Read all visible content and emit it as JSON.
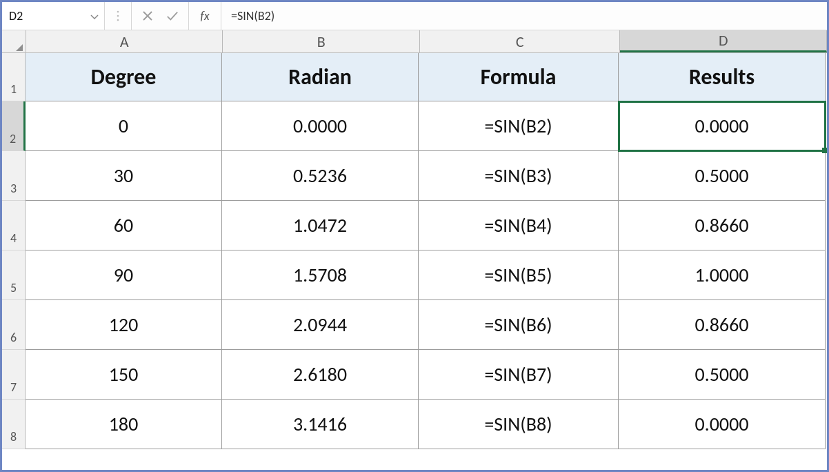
{
  "nameBox": {
    "value": "D2"
  },
  "formulaBar": {
    "fxLabel": "fx",
    "formula": "=SIN(B2)"
  },
  "columns": [
    "A",
    "B",
    "C",
    "D"
  ],
  "headers": {
    "A": "Degree",
    "B": "Radian",
    "C": "Formula",
    "D": "Results"
  },
  "selected": {
    "col": "D",
    "row": 2
  },
  "rows": [
    {
      "n": "1"
    },
    {
      "n": "2",
      "A": "0",
      "B": "0.0000",
      "C": "=SIN(B2)",
      "D": "0.0000"
    },
    {
      "n": "3",
      "A": "30",
      "B": "0.5236",
      "C": "=SIN(B3)",
      "D": "0.5000"
    },
    {
      "n": "4",
      "A": "60",
      "B": "1.0472",
      "C": "=SIN(B4)",
      "D": "0.8660"
    },
    {
      "n": "5",
      "A": "90",
      "B": "1.5708",
      "C": "=SIN(B5)",
      "D": "1.0000"
    },
    {
      "n": "6",
      "A": "120",
      "B": "2.0944",
      "C": "=SIN(B6)",
      "D": "0.8660"
    },
    {
      "n": "7",
      "A": "150",
      "B": "2.6180",
      "C": "=SIN(B7)",
      "D": "0.5000"
    },
    {
      "n": "8",
      "A": "180",
      "B": "3.1416",
      "C": "=SIN(B8)",
      "D": "0.0000"
    }
  ]
}
